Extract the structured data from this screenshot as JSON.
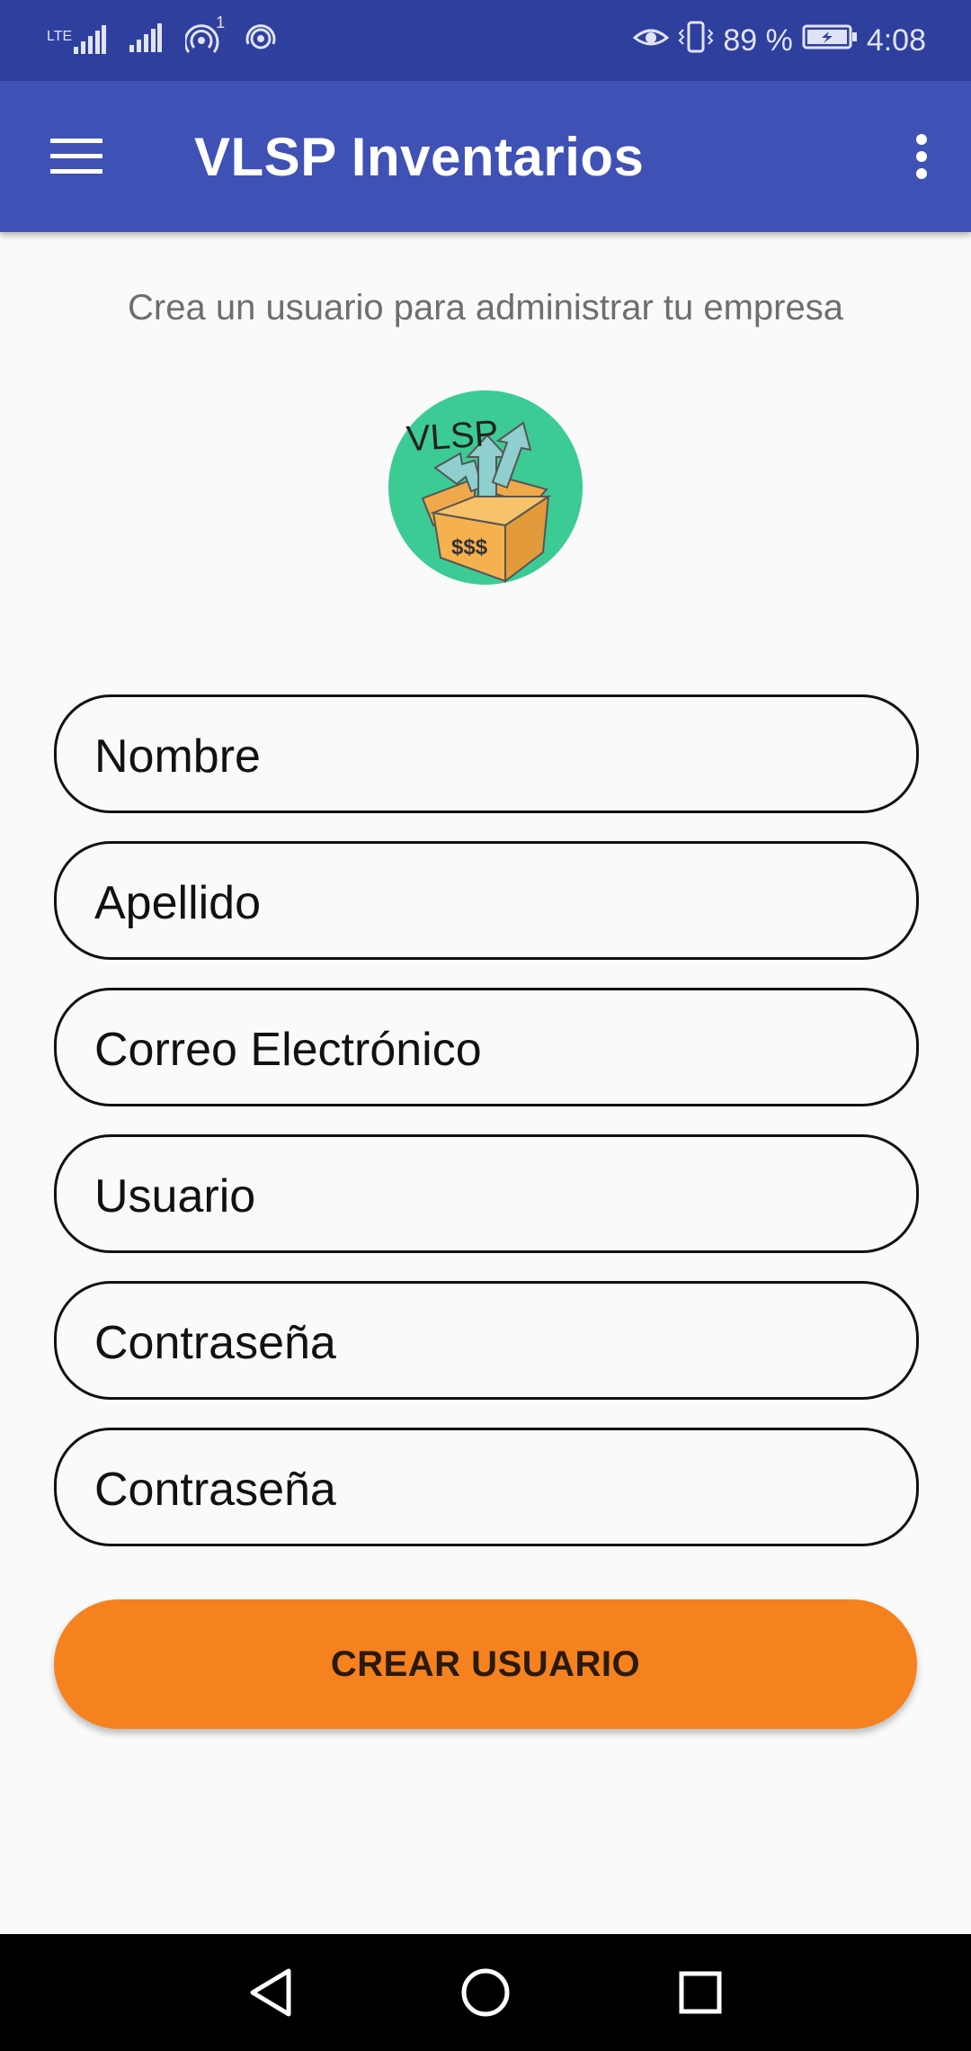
{
  "status_bar": {
    "network_label": "LTE",
    "notification_count": "1",
    "battery": "89 %",
    "time": "4:08",
    "icons": [
      "lte-signal-icon",
      "signal-icon",
      "hotspot-icon",
      "wireless-icon",
      "eye-comfort-icon",
      "vibrate-icon",
      "battery-charging-icon"
    ]
  },
  "app_bar": {
    "title": "VLSP Inventarios",
    "menu_icon": "hamburger-menu-icon",
    "overflow_icon": "more-vertical-icon"
  },
  "page": {
    "subtitle": "Crea un usuario para administrar tu empresa",
    "logo": {
      "text": "VLSP",
      "box_text": "$$$",
      "colors": {
        "circle": "#3dcb95",
        "box": "#f5b04f",
        "arrows": "#8fcfcf"
      }
    }
  },
  "form": {
    "fields": [
      {
        "placeholder": "Nombre"
      },
      {
        "placeholder": "Apellido"
      },
      {
        "placeholder": "Correo Electrónico"
      },
      {
        "placeholder": "Usuario"
      },
      {
        "placeholder": "Contraseña"
      },
      {
        "placeholder": "Contraseña"
      }
    ],
    "submit_label": "CREAR USUARIO"
  },
  "nav_bar": {
    "icons": [
      "back-icon",
      "home-icon",
      "recents-icon"
    ]
  },
  "colors": {
    "status_bar": "#2f3f9e",
    "app_bar": "#3f51b5",
    "accent": "#f5821f",
    "background": "#fafafa"
  }
}
